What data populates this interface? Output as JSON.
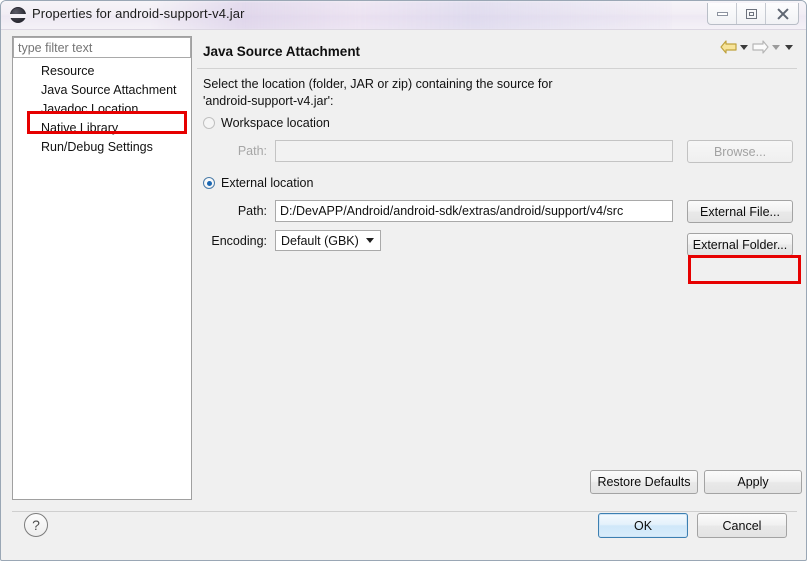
{
  "window": {
    "title": "Properties for android-support-v4.jar",
    "app_icon": "eclipse-icon",
    "controls": {
      "minimize": "minimize-icon",
      "maximize": "restore-icon",
      "close": "close-icon"
    }
  },
  "sidebar": {
    "filter": {
      "value": "",
      "placeholder": "type filter text"
    },
    "items": [
      {
        "label": "Resource",
        "selected": false
      },
      {
        "label": "Java Source Attachment",
        "selected": true
      },
      {
        "label": "Javadoc Location",
        "selected": false
      },
      {
        "label": "Native Library",
        "selected": false
      },
      {
        "label": "Run/Debug Settings",
        "selected": false
      }
    ]
  },
  "main": {
    "title": "Java Source Attachment",
    "nav": {
      "back": "back-arrow-icon",
      "back_menu": "chevron-down-icon",
      "forward": "forward-arrow-icon",
      "forward_menu": "chevron-down-icon",
      "view_menu": "chevron-down-icon"
    },
    "description_line1": "Select the location (folder, JAR or zip) containing the source for",
    "description_line2": "'android-support-v4.jar':",
    "workspace": {
      "radio_label": "Workspace location",
      "selected": false,
      "path_label": "Path:",
      "path_value": "",
      "browse_label": "Browse..."
    },
    "external": {
      "radio_label": "External location",
      "selected": true,
      "path_label": "Path:",
      "path_value": "D:/DevAPP/Android/android-sdk/extras/android/support/v4/src",
      "external_file_label": "External File...",
      "external_folder_label": "External Folder..."
    },
    "encoding": {
      "label": "Encoding:",
      "value": "Default (GBK)",
      "options": [
        "Default (GBK)"
      ]
    },
    "restore_defaults_label": "Restore Defaults",
    "apply_label": "Apply"
  },
  "footer": {
    "help": "?",
    "ok_label": "OK",
    "cancel_label": "Cancel"
  },
  "annotations": {
    "color": "#e60000",
    "boxes": [
      "java-source-attachment-tree-item",
      "external-folder-button"
    ]
  }
}
